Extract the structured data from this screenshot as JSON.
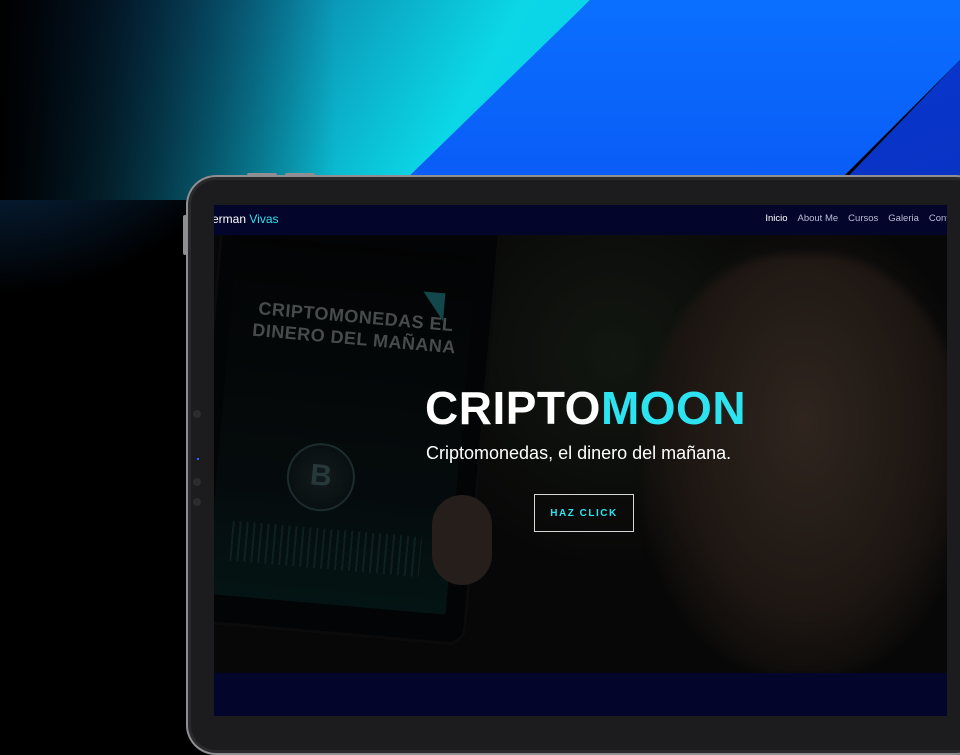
{
  "site": {
    "brand_first": "erman",
    "brand_second": "Vivas",
    "nav": [
      "Inicio",
      "About Me",
      "Cursos",
      "Galeria",
      "Contac"
    ]
  },
  "hero": {
    "title_white": "CRIPTO",
    "title_accent": "MOON",
    "subtitle": "Criptomonedas, el dinero del mañana.",
    "cta_label": "HAZ CLICK",
    "phone_title": "CRIPTOMONEDAS EL DINERO DEL MAÑANA",
    "phone_coin": "B"
  },
  "colors": {
    "accent": "#2ee3f0",
    "nav_bg": "#03052a"
  }
}
